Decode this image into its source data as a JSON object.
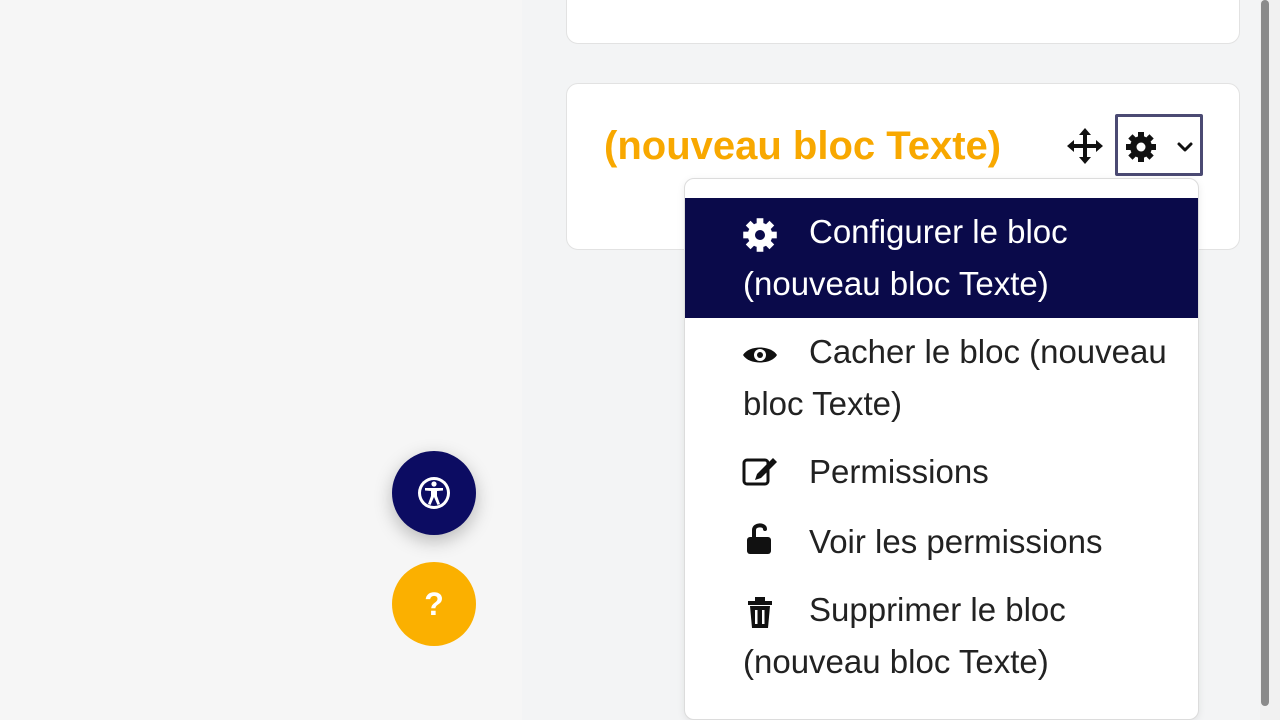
{
  "block": {
    "title": "(nouveau bloc Texte)"
  },
  "menu": {
    "items": [
      {
        "label": "Configurer le bloc (nouveau bloc Texte)",
        "icon": "gear-icon"
      },
      {
        "label": "Cacher le bloc (nouveau bloc Texte)",
        "icon": "eye-icon"
      },
      {
        "label": "Permissions",
        "icon": "edit-icon"
      },
      {
        "label": "Voir les permissions",
        "icon": "unlock-icon"
      },
      {
        "label": "Supprimer le bloc (nouveau bloc Texte)",
        "icon": "trash-icon"
      }
    ]
  },
  "fab": {
    "help_label": "?"
  },
  "colors": {
    "accent": "#f8a800",
    "navy": "#0a0a4a",
    "help": "#fbb000"
  }
}
